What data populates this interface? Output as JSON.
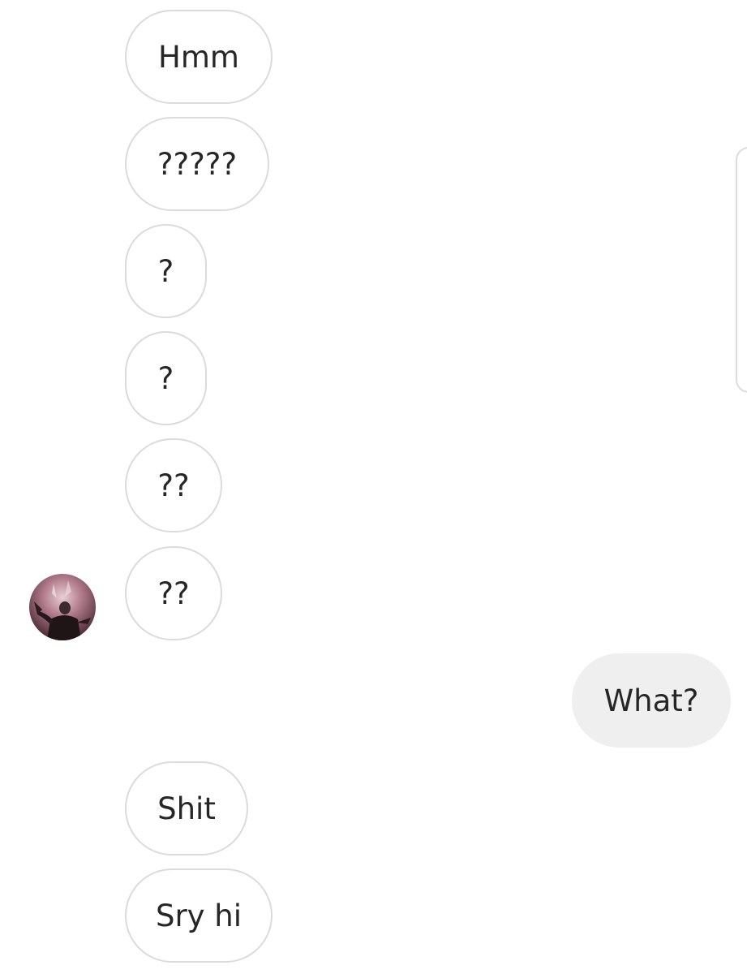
{
  "thread": {
    "messages": [
      {
        "sender": "them",
        "text": "Hmm"
      },
      {
        "sender": "them",
        "text": "?????"
      },
      {
        "sender": "them",
        "text": "?"
      },
      {
        "sender": "them",
        "text": "?"
      },
      {
        "sender": "them",
        "text": "??"
      },
      {
        "sender": "them",
        "text": "??"
      },
      {
        "sender": "me",
        "text": "What?"
      },
      {
        "sender": "them",
        "text": "Shit"
      },
      {
        "sender": "them",
        "text": "Sry hi"
      }
    ]
  },
  "colors": {
    "incoming_border": "#dbdbdb",
    "incoming_background": "#ffffff",
    "outgoing_background": "#efefef",
    "text": "#262626"
  },
  "icons": {
    "avatar": "profile-avatar-illustration",
    "edge_panel": "edge-panel-handle"
  }
}
